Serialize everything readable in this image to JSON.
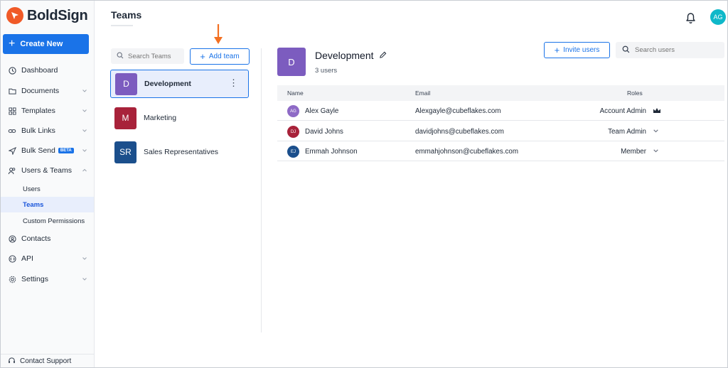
{
  "app": {
    "name": "BoldSign"
  },
  "sidebar": {
    "create_label": "Create New",
    "items": [
      {
        "label": "Dashboard",
        "icon": "clock-icon",
        "chevron": false
      },
      {
        "label": "Documents",
        "icon": "folder-icon",
        "chevron": true
      },
      {
        "label": "Templates",
        "icon": "grid-icon",
        "chevron": true
      },
      {
        "label": "Bulk Links",
        "icon": "link-icon",
        "chevron": true
      },
      {
        "label": "Bulk Send",
        "icon": "send-icon",
        "chevron": true,
        "badge": "BETA"
      },
      {
        "label": "Users & Teams",
        "icon": "users-icon",
        "chevron": true,
        "expanded": true
      },
      {
        "label": "Contacts",
        "icon": "contacts-icon",
        "chevron": false
      },
      {
        "label": "API",
        "icon": "api-icon",
        "chevron": true
      },
      {
        "label": "Settings",
        "icon": "gear-icon",
        "chevron": true
      }
    ],
    "sub_items": [
      {
        "label": "Users"
      },
      {
        "label": "Teams",
        "active": true
      },
      {
        "label": "Custom Permissions"
      }
    ],
    "support_label": "Contact Support"
  },
  "header": {
    "title": "Teams",
    "user_initials": "AG"
  },
  "teams_panel": {
    "search_placeholder": "Search Teams",
    "add_team_label": "Add team",
    "teams": [
      {
        "initial": "D",
        "name": "Development",
        "color": "#7c5cbf",
        "selected": true
      },
      {
        "initial": "M",
        "name": "Marketing",
        "color": "#a8223a",
        "selected": false
      },
      {
        "initial": "SR",
        "name": "Sales Representatives",
        "color": "#1b4f8c",
        "selected": false
      }
    ]
  },
  "team_detail": {
    "initial": "D",
    "name": "Development",
    "user_count": "3 users",
    "invite_label": "Invite users",
    "search_placeholder": "Search users",
    "columns": {
      "name": "Name",
      "email": "Email",
      "roles": "Roles"
    },
    "members": [
      {
        "initials": "AG",
        "name": "Alex Gayle",
        "email": "Alexgayle@cubeflakes.com",
        "role": "Account Admin",
        "role_icon": "crown-icon",
        "color": "#8e6ac6"
      },
      {
        "initials": "DJ",
        "name": "David Johns",
        "email": "davidjohns@cubeflakes.com",
        "role": "Team Admin",
        "role_icon": "chevron-down-icon",
        "color": "#a8223a"
      },
      {
        "initials": "EJ",
        "name": "Emmah Johnson",
        "email": "emmahjohnson@cubeflakes.com",
        "role": "Member",
        "role_icon": "chevron-down-icon",
        "color": "#1b4f8c"
      }
    ]
  },
  "colors": {
    "primary": "#1a73e8",
    "brand": "#f05a28",
    "annotation_arrow": "#f37021"
  }
}
